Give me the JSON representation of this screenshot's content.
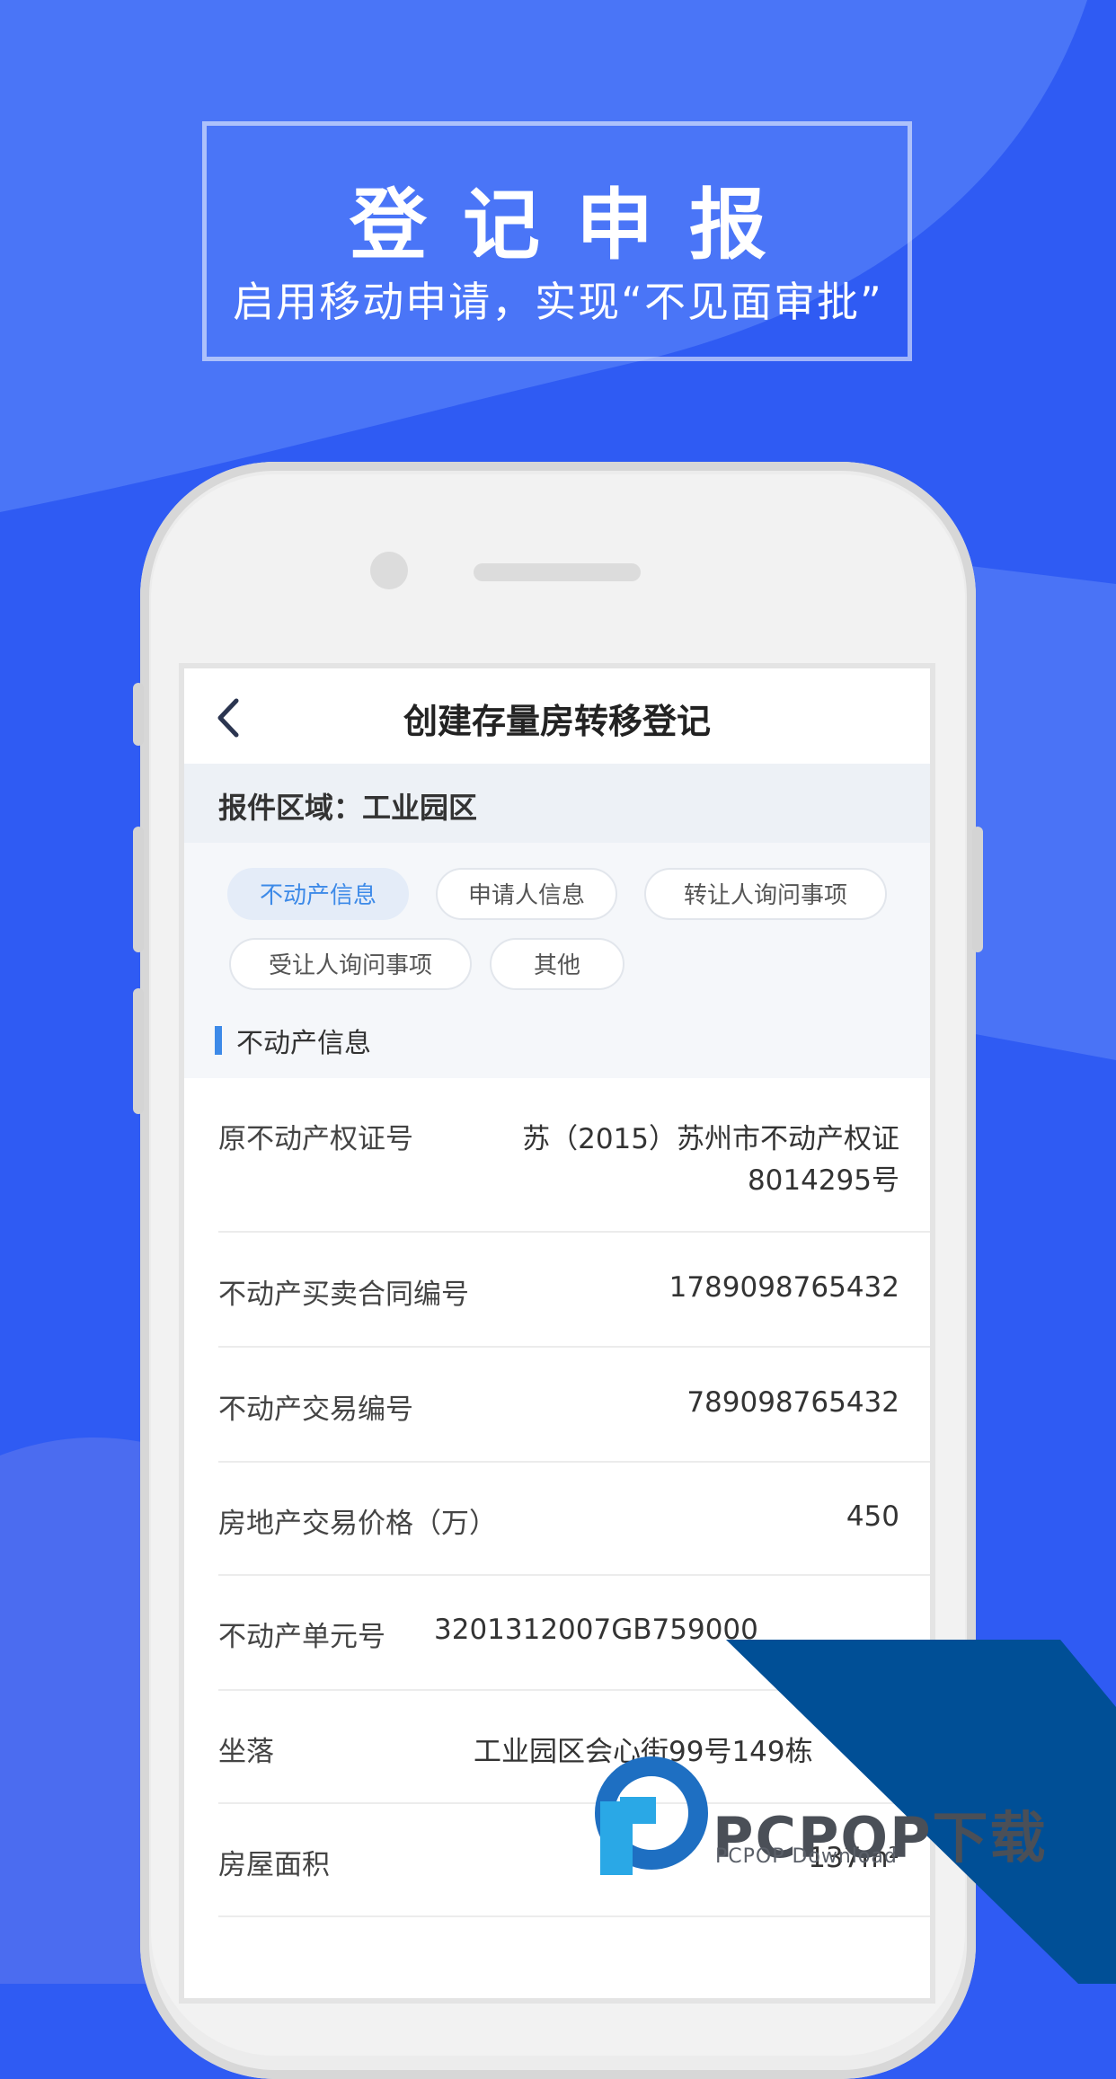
{
  "header": {
    "title": "登记申报",
    "subtitle": "启用移动申请，实现“不见面审批”"
  },
  "nav": {
    "title": "创建存量房转移登记",
    "back_icon": "chevron-left-icon"
  },
  "region": {
    "label": "报件区域：工业园区"
  },
  "tabs": [
    {
      "label": "不动产信息",
      "active": true
    },
    {
      "label": "申请人信息",
      "active": false
    },
    {
      "label": "转让人询问事项",
      "active": false
    },
    {
      "label": "受让人询问事项",
      "active": false
    },
    {
      "label": "其他",
      "active": false
    }
  ],
  "section": {
    "title": "不动产信息"
  },
  "fields": [
    {
      "label": "原不动产权证号",
      "value_line1": "苏（2015）苏州市不动产权证",
      "value_line2": "8014295号"
    },
    {
      "label": "不动产买卖合同编号",
      "value": "1789098765432"
    },
    {
      "label": "不动产交易编号",
      "value": "789098765432"
    },
    {
      "label": "房地产交易价格（万）",
      "value": "450"
    },
    {
      "label": "不动产单元号",
      "value": "3201312007GB759000"
    },
    {
      "label": "坐落",
      "value": "工业园区会心街99号149栋"
    },
    {
      "label": "房屋面积",
      "value": "137m²"
    }
  ],
  "watermark": {
    "brand": "PCPOP下载",
    "sub": "PCPOP Download"
  },
  "colors": {
    "background": "#2f5bf3",
    "accent": "#3d8ae8",
    "watermark_band": "#004f96"
  }
}
